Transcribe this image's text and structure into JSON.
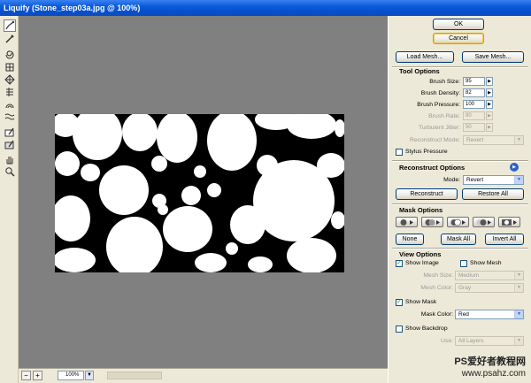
{
  "window": {
    "title": "Liquify (Stone_step03a.jpg @ 100%)"
  },
  "toolbox": {
    "tools": [
      {
        "name": "forward-warp-tool-icon"
      },
      {
        "name": "reconstruct-tool-icon"
      },
      {
        "name": "twirl-clockwise-tool-icon"
      },
      {
        "name": "pucker-tool-icon"
      },
      {
        "name": "bloat-tool-icon"
      },
      {
        "name": "push-left-tool-icon"
      },
      {
        "name": "mirror-tool-icon"
      },
      {
        "name": "turbulence-tool-icon"
      },
      {
        "name": "freeze-mask-tool-icon"
      },
      {
        "name": "thaw-mask-tool-icon"
      },
      {
        "name": "hand-tool-icon"
      },
      {
        "name": "zoom-tool-icon"
      }
    ]
  },
  "zoom": {
    "minus": "−",
    "plus": "+",
    "value": "100%"
  },
  "buttons": {
    "ok": "OK",
    "cancel": "Cancel",
    "load_mesh": "Load Mesh...",
    "save_mesh": "Save Mesh..."
  },
  "tool_options": {
    "title": "Tool Options",
    "brush_size_label": "Brush Size:",
    "brush_size": "95",
    "brush_density_label": "Brush Density:",
    "brush_density": "82",
    "brush_pressure_label": "Brush Pressure:",
    "brush_pressure": "100",
    "brush_rate_label": "Brush Rate:",
    "brush_rate": "80",
    "turbulent_jitter_label": "Turbulent Jitter:",
    "turbulent_jitter": "50",
    "reconstruct_mode_label": "Reconstruct Mode:",
    "reconstruct_mode": "Revert",
    "stylus_pressure_label": "Stylus Pressure"
  },
  "reconstruct_options": {
    "title": "Reconstruct Options",
    "mode_label": "Mode:",
    "mode": "Revert",
    "reconstruct_button": "Reconstruct",
    "restore_all_button": "Restore All"
  },
  "mask_options": {
    "title": "Mask Options",
    "none_button": "None",
    "mask_all_button": "Mask All",
    "invert_all_button": "Invert All"
  },
  "view_options": {
    "title": "View Options",
    "show_image": "Show Image",
    "show_mesh": "Show Mesh",
    "mesh_size_label": "Mesh Size:",
    "mesh_size": "Medium",
    "mesh_color_label": "Mesh Color:",
    "mesh_color": "Gray",
    "show_mask": "Show Mask",
    "mask_color_label": "Mask Color:",
    "mask_color": "Red",
    "show_backdrop": "Show Backdrop",
    "use_label": "Use:",
    "use_value": "All Layers"
  },
  "watermark": {
    "line1": "PS爱好者教程网",
    "line2": "www.psahz.com"
  },
  "colors": {
    "title_blue": "#0a5bd8",
    "canvas_gray": "#808080",
    "panel_bg": "#ece9d8",
    "accent_orange": "#f7c84a"
  }
}
